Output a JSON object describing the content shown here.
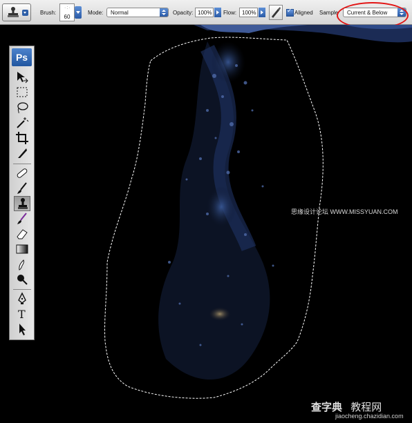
{
  "options_bar": {
    "brush_label": "Brush:",
    "brush_size": "60",
    "mode_label": "Mode:",
    "mode_value": "Normal",
    "opacity_label": "Opacity:",
    "opacity_value": "100%",
    "flow_label": "Flow:",
    "flow_value": "100%",
    "aligned_label": "Aligned",
    "aligned_checked": true,
    "sample_label": "Sample",
    "sample_value": "Current & Below",
    "highlight_color": "#e21414"
  },
  "toolbox": {
    "logo": "Ps",
    "tools": [
      {
        "name": "move-tool-icon"
      },
      {
        "name": "marquee-tool-icon"
      },
      {
        "name": "lasso-tool-icon"
      },
      {
        "name": "magic-wand-tool-icon"
      },
      {
        "name": "crop-tool-icon"
      },
      {
        "name": "slice-tool-icon"
      },
      {
        "name": "healing-brush-tool-icon"
      },
      {
        "name": "brush-tool-icon"
      },
      {
        "name": "clone-stamp-tool-icon",
        "active": true
      },
      {
        "name": "history-brush-tool-icon"
      },
      {
        "name": "eraser-tool-icon"
      },
      {
        "name": "gradient-tool-icon"
      },
      {
        "name": "smudge-tool-icon"
      },
      {
        "name": "dodge-tool-icon"
      },
      {
        "name": "pen-tool-icon"
      },
      {
        "name": "type-tool-icon",
        "glyph": "T"
      },
      {
        "name": "path-selection-tool-icon"
      }
    ]
  },
  "watermarks": {
    "site_cn": "思缘设计论坛 WWW.MISSYUAN.COM",
    "brand_cn": "查字典",
    "brand_cn2": "教程网",
    "brand_url": "jiaocheng.chazidian.com"
  }
}
